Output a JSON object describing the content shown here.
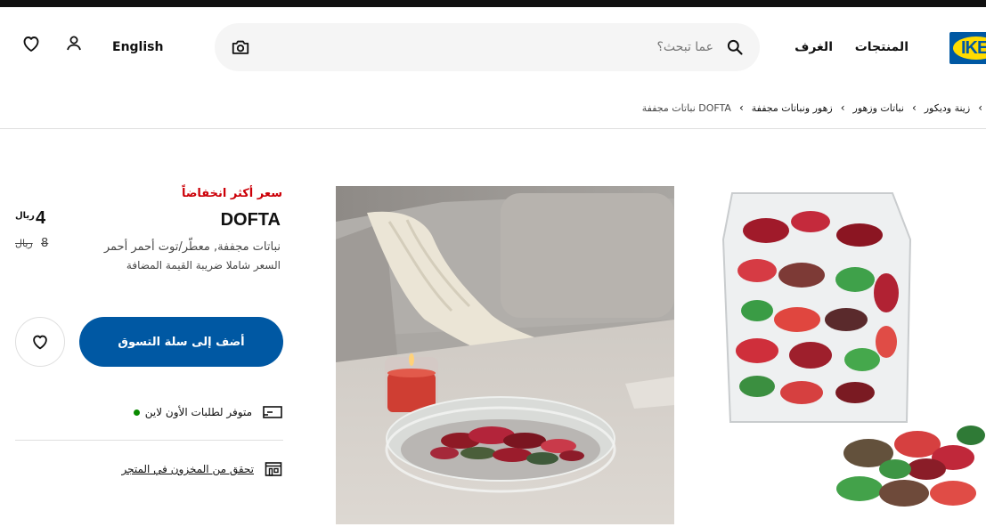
{
  "header": {
    "logo_text": "IKEA",
    "nav": {
      "products": "المنتجات",
      "rooms": "الغرف"
    },
    "search": {
      "placeholder": "عما تبحث؟"
    },
    "language": "English"
  },
  "breadcrumbs": [
    "زينة وديكور",
    "نباتات وزهور",
    "زهور ونباتات مجففة",
    "DOFTA نباتات مجففة"
  ],
  "product": {
    "badge": "سعر أكثر انخفاضاً",
    "name": "DOFTA",
    "description": "نباتات مجففة, معطّر/توت أحمر أحمر",
    "vat_note": "السعر شاملا ضريبة القيمة المضافة",
    "price": "4",
    "currency": "ريال",
    "old_price": "8",
    "old_currency": "ريال"
  },
  "actions": {
    "add_to_cart": "أضف إلى سلة التسوق"
  },
  "availability": {
    "online": "متوفر لطلبات الأون لاين",
    "online_status_color": "#0a8a00",
    "store_check": "تحقق من المخزون في المتجر"
  },
  "colors": {
    "brand_blue": "#0058a3",
    "brand_yellow": "#ffdb00",
    "sale_red": "#cc0008"
  },
  "icons": {
    "search": "search-icon",
    "camera": "camera-icon",
    "user": "user-icon",
    "heart": "heart-icon",
    "delivery": "delivery-truck-icon",
    "store": "store-icon"
  }
}
